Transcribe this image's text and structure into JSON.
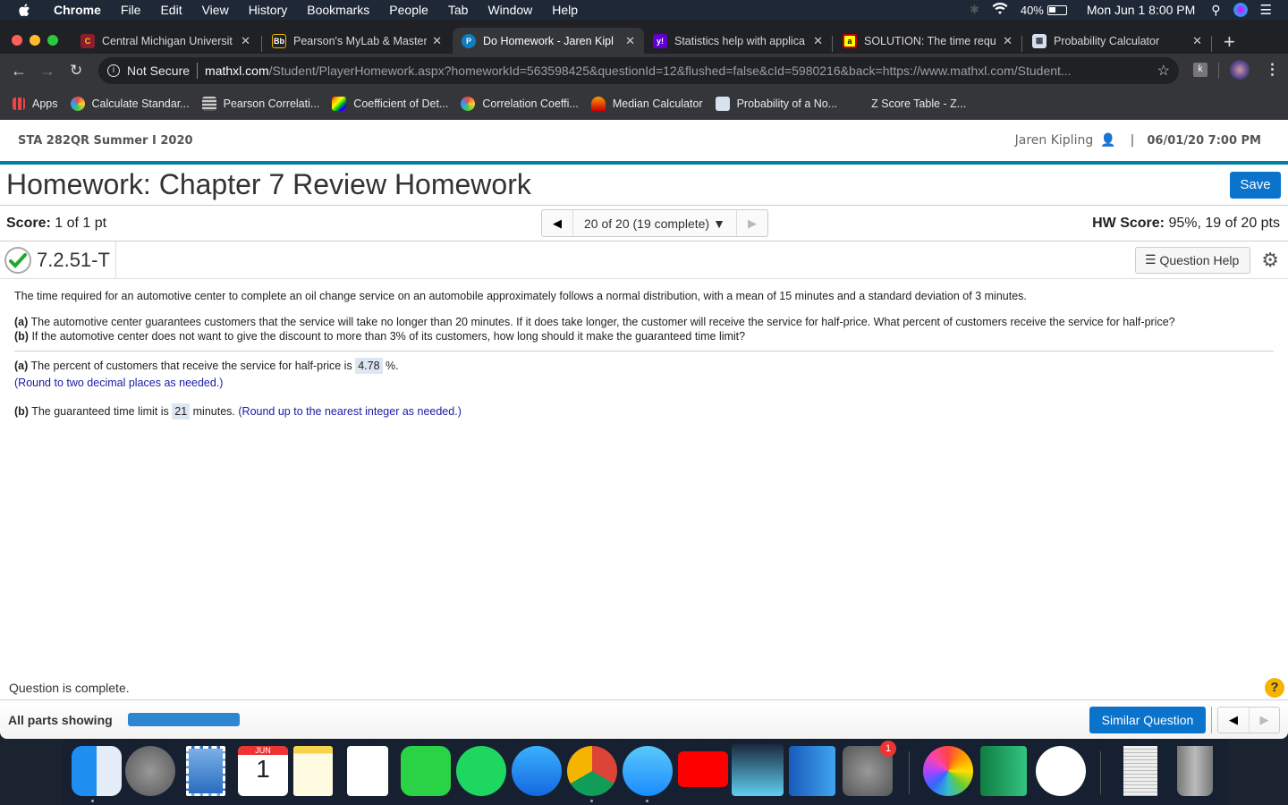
{
  "menubar": {
    "app": "Chrome",
    "items": [
      "File",
      "Edit",
      "View",
      "History",
      "Bookmarks",
      "People",
      "Tab",
      "Window",
      "Help"
    ],
    "battery": "40%",
    "clock": "Mon Jun 1  8:00 PM"
  },
  "browser": {
    "tabs": [
      {
        "title": "Central Michigan Universit",
        "icon": "cmu-icon",
        "active": false
      },
      {
        "title": "Pearson's MyLab & Master",
        "icon": "blackboard-icon",
        "active": false
      },
      {
        "title": "Do Homework - Jaren Kipl",
        "icon": "pearson-icon",
        "active": true
      },
      {
        "title": "Statistics help with applica",
        "icon": "yahoo-icon",
        "active": false
      },
      {
        "title": "SOLUTION: The time requ",
        "icon": "solution-icon",
        "active": false
      },
      {
        "title": "Probability Calculator",
        "icon": "calculator-icon",
        "active": false
      }
    ],
    "new_tab": "+",
    "address": {
      "security": "Not Secure",
      "domain": "mathxl.com",
      "path": "/Student/PlayerHomework.aspx?homeworkId=563598425&questionId=12&flushed=false&cId=5980216&back=https://www.mathxl.com/Student..."
    },
    "bookmarks": [
      {
        "label": "Apps",
        "icon": "apps-grid-icon"
      },
      {
        "label": "Calculate Standar...",
        "icon": "calculator-icon"
      },
      {
        "label": "Pearson Correlati...",
        "icon": "page-icon"
      },
      {
        "label": "Coefficient of Det...",
        "icon": "rainbow-icon"
      },
      {
        "label": "Correlation Coeffi...",
        "icon": "calculator-icon"
      },
      {
        "label": "Median Calculator",
        "icon": "arch-icon"
      },
      {
        "label": "Probability of a No...",
        "icon": "calculator-icon"
      },
      {
        "label": "Z Score Table - Z...",
        "icon": "blank-icon"
      }
    ]
  },
  "page": {
    "course": "STA 282QR Summer I 2020",
    "user": "Jaren Kipling",
    "due": "06/01/20 7:00 PM",
    "title": "Homework: Chapter 7 Review Homework",
    "save_label": "Save",
    "score_label": "Score:",
    "score_value": "1 of 1 pt",
    "question_nav": "20 of 20 (19 complete)",
    "hw_score_label": "HW Score:",
    "hw_score_value": "95%, 19 of 20 pts",
    "question_id": "7.2.51-T",
    "question_help": "Question Help",
    "problem": "The time required for an automotive center to complete an oil change service on an automobile approximately follows a normal distribution, with a mean of 15 minutes and a standard deviation of 3 minutes.",
    "part_a_label": "(a)",
    "part_a_q": "The automotive center guarantees customers that the service will take no longer than 20 minutes. If it does take longer, the customer will receive the service for half-price. What percent of customers receive the service for half-price?",
    "part_b_label": "(b)",
    "part_b_q": "If the automotive center does not want to give the discount to more than 3% of its customers, how long should it make the guaranteed time limit?",
    "answer_a_text": "The percent of customers that receive the service for half-price is",
    "answer_a_value": "4.78",
    "answer_a_suffix": "%.",
    "answer_a_hint": "(Round to two decimal places as needed.)",
    "answer_b_text": "The guaranteed time limit is",
    "answer_b_value": "21",
    "answer_b_suffix": "minutes.",
    "answer_b_hint": "(Round up to the nearest integer as needed.)",
    "status": "Question is complete.",
    "all_parts": "All parts showing",
    "similar_question": "Similar Question",
    "colors": {
      "accent": "#0a73cc",
      "header_rule": "#007fa3",
      "hint": "#1a1aa6",
      "answer_bg": "#dde6f3"
    }
  },
  "dock": {
    "apps": [
      "Finder",
      "Launchpad",
      "Mail",
      "Calendar",
      "Notes",
      "Reminders",
      "FaceTime",
      "Spotify",
      "App Store",
      "Chrome",
      "Messages",
      "YouTube",
      "Kindle",
      "Word",
      "System Preferences",
      "Photos",
      "Excel",
      "iTunes",
      "XLS Document",
      "Trash"
    ],
    "calendar_month": "JUN",
    "calendar_day": "1",
    "sysprefs_badge": "1"
  }
}
